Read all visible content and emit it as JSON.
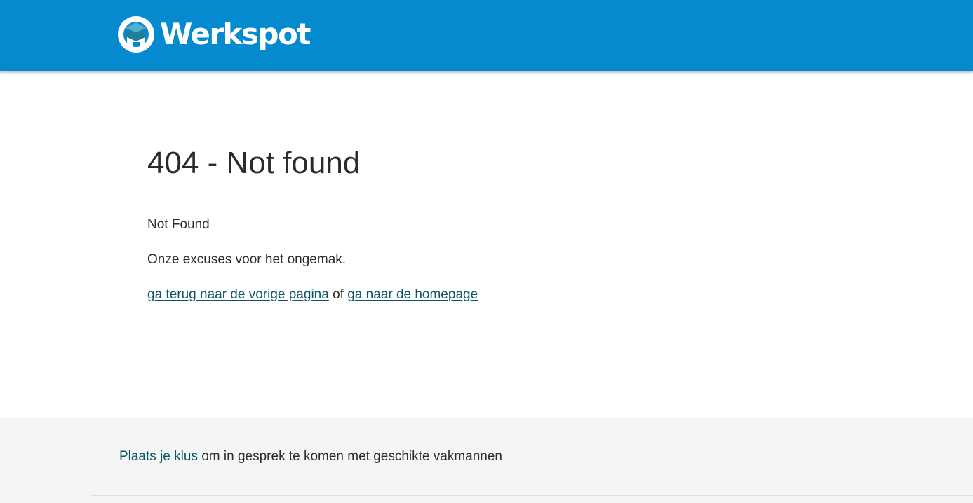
{
  "header": {
    "brand_name": "Werkspot",
    "logo_icon": "werkspot-logo-icon",
    "background_color": "#0589cf"
  },
  "main": {
    "title": "404 - Not found",
    "message": "Not Found",
    "apology": "Onze excuses voor het ongemak.",
    "back_link": "ga terug naar de vorige pagina",
    "separator": " of ",
    "home_link": "ga naar de homepage"
  },
  "footer": {
    "cta_link": "Plaats je klus",
    "cta_text": " om in gesprek te komen met geschikte vakmannen",
    "background_color": "#f4f6f5"
  },
  "colors": {
    "link": "#0b5566",
    "text": "#2b2b2b"
  }
}
